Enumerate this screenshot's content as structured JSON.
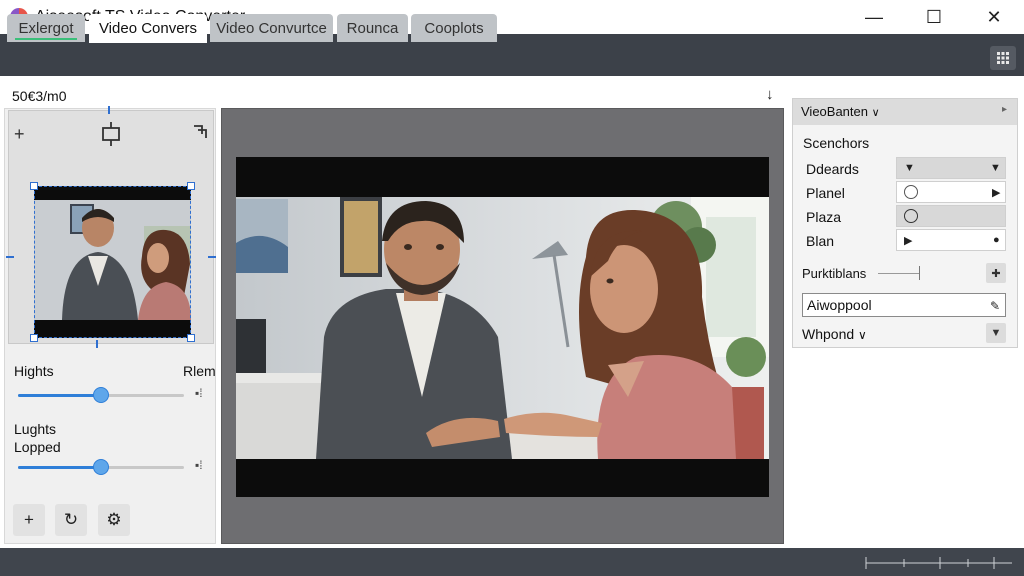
{
  "window": {
    "title": "Aiseesoft TS Video Converter",
    "minimize_glyph": "—",
    "maximize_glyph": "☐",
    "close_glyph": "✕"
  },
  "tabs": [
    {
      "label": "Exlergot",
      "active": false
    },
    {
      "label": "Video Convers",
      "active": true
    },
    {
      "label": "Video Convurtce",
      "active": false
    },
    {
      "label": "Rounca",
      "active": false
    },
    {
      "label": "Cooplots",
      "active": false
    }
  ],
  "toolbar": {
    "zoom_readout": "50€3/m0",
    "download_icon": "download-arrow"
  },
  "crop_panel": {
    "tools": [
      "move-plus-icon",
      "crop-frame-icon",
      "rotate-corner-icon"
    ],
    "sliders": [
      {
        "label": "Hights",
        "right_label": "Rlem",
        "value": 0.5
      },
      {
        "label": "Lughts\nLopped",
        "right_label": "",
        "value": 0.5
      }
    ],
    "buttons": [
      "+",
      "↻",
      "⚙"
    ]
  },
  "right_panel": {
    "header": "VieoBanten",
    "section_label": "Scenchors",
    "rows": [
      {
        "label": "Ddeards",
        "control": "dropdown"
      },
      {
        "label": "Planel",
        "control": "radio"
      },
      {
        "label": "Plaza",
        "control": "radio-plain"
      },
      {
        "label": "Blan",
        "control": "arrow"
      }
    ],
    "slider_label": "Purktiblans",
    "input_value": "Aiwoppool",
    "dropdown_label": "Whpond",
    "chevron": "∨"
  },
  "colors": {
    "accent": "#2f7fd8",
    "tab_bar": "#3c4149",
    "status_bar": "#40454d",
    "preview_bg": "#6e6e71",
    "active_tab_underline": "#3bbf7a"
  }
}
